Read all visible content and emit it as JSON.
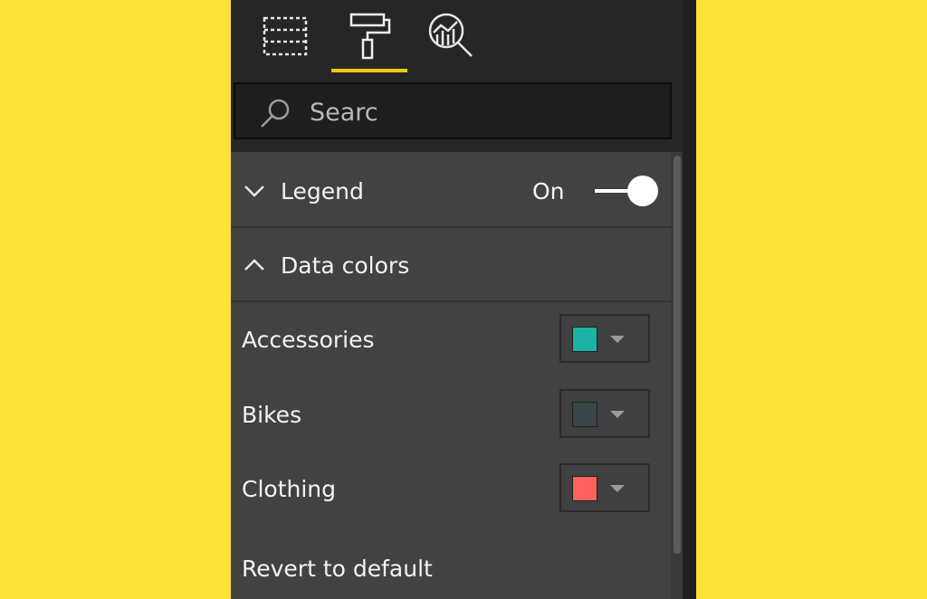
{
  "tabs": [
    {
      "name": "fields",
      "icon": "fields-icon",
      "active": false
    },
    {
      "name": "format",
      "icon": "paint-roller-icon",
      "active": true
    },
    {
      "name": "analytics",
      "icon": "analytics-icon",
      "active": false
    }
  ],
  "search": {
    "placeholder": "Searc",
    "value": ""
  },
  "legend": {
    "label": "Legend",
    "state_label": "On",
    "enabled": true,
    "expanded": false
  },
  "data_colors": {
    "label": "Data colors",
    "expanded": true,
    "items": [
      {
        "label": "Accessories",
        "color": "#1AB3A6"
      },
      {
        "label": "Bikes",
        "color": "#374649"
      },
      {
        "label": "Clothing",
        "color": "#FD625E"
      }
    ],
    "revert_label": "Revert to default"
  },
  "colors": {
    "background": "#FDE338",
    "panel": "#424242",
    "accent": "#F2C811"
  }
}
